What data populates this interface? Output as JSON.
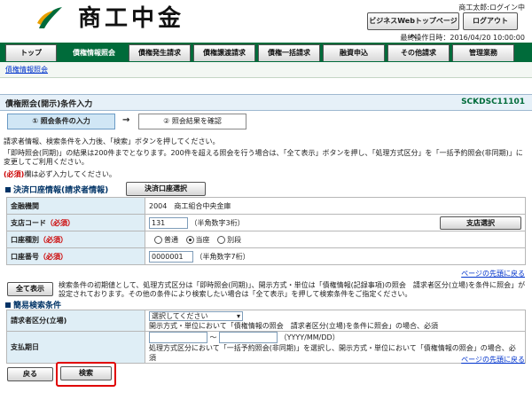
{
  "header": {
    "logo_text": "商工中金",
    "user_label": "商工太郎:ログイン中",
    "web_top_button": "ビジネスWebトップページへ",
    "logout_button": "ログアウト",
    "last_operation": "最終操作日時：2016/04/20 10:00:00",
    "logo_colors": [
      "#e8a000",
      "#006b3a"
    ]
  },
  "tabs": [
    {
      "label": "トップ"
    },
    {
      "label": "債権情報照会"
    },
    {
      "label": "債権発生請求"
    },
    {
      "label": "債権譲渡請求"
    },
    {
      "label": "債権一括請求"
    },
    {
      "label": "融資申込"
    },
    {
      "label": "その他請求"
    },
    {
      "label": "管理業務"
    }
  ],
  "breadcrumb": "債権情報照会",
  "page": {
    "title": "債権照会(開示)条件入力",
    "screen_code": "SCKDSC11101"
  },
  "steps": [
    {
      "num": "①",
      "label": "照会条件の入力"
    },
    {
      "num": "②",
      "label": "照会結果を確認"
    }
  ],
  "step_arrow": "→",
  "instructions": {
    "line1": "請求者情報、検索条件を入力後、「検索」ボタンを押してください。",
    "line2": "「即時照会(同期)」の結果は200件までとなります。200件を超える照会を行う場合は、「全て表示」ボタンを押し、「処理方式区分」を「一括予約照会(非同期)」に変更してご利用ください。",
    "required_note_prefix": "(必須)",
    "required_note_suffix": "欄は必ず入力してください。"
  },
  "settlement_section": {
    "title": "決済口座情報(請求者情報)",
    "select_button": "決済口座選択",
    "rows": {
      "bank_label": "金融機関",
      "bank_value": "2004　商工組合中央金庫",
      "branch_label": "支店コード",
      "branch_required": "（必須）",
      "branch_value": "131",
      "branch_hint": "（半角数字3桁）",
      "branch_button": "支店選択",
      "account_type_label": "口座種別",
      "account_type_required": "（必須）",
      "account_type_options": [
        "普通",
        "当座",
        "別段"
      ],
      "account_type_selected": "当座",
      "account_no_label": "口座番号",
      "account_no_required": "（必須）",
      "account_no_value": "0000001",
      "account_no_hint": "（半角数字7桁）"
    },
    "page_top_link": "ページの先頭に戻る"
  },
  "show_all": {
    "button": "全て表示",
    "note": "検索条件の初期値として、処理方式区分は「即時照会(同期)」、開示方式・単位は「債権情報(記録事項)の照会　請求者区分(立場)を条件に照会」が設定されております。その他の条件により検索したい場合は「全て表示」を押して検索条件をご指定ください。"
  },
  "simple_search": {
    "title": "簡易検索条件",
    "requester_label": "請求者区分(立場)",
    "requester_select": "選択してください",
    "requester_note": "開示方式・単位において「債権情報の照会　請求者区分(立場)を条件に照会」の場合、必須",
    "due_date_label": "支払期日",
    "due_date_separator": "～",
    "due_date_hint": "（YYYY/MM/DD）",
    "due_date_note": "処理方式区分において「一括予約照会(非同期)」を選択し、開示方式・単位において「債権情報の照会」の場合、必須",
    "page_top_link": "ページの先頭に戻る"
  },
  "footer": {
    "back_button": "戻る",
    "search_button": "検索"
  }
}
